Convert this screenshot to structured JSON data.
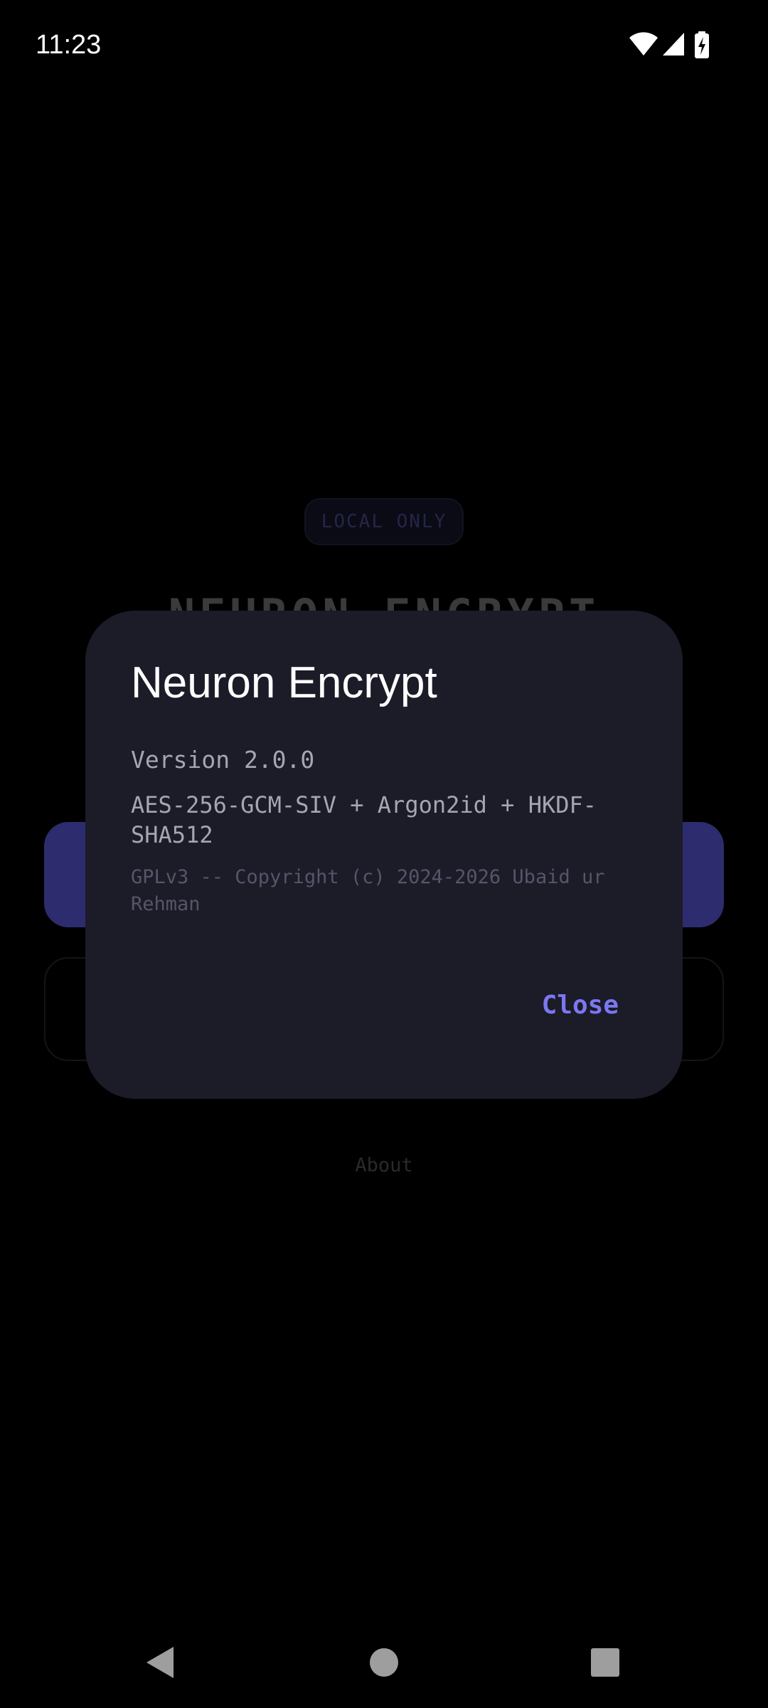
{
  "status_bar": {
    "time": "11:23",
    "icons": [
      "wifi-icon",
      "cellular-signal-icon",
      "battery-charging-icon"
    ]
  },
  "background": {
    "badge": "LOCAL ONLY",
    "title": "NEURON ENCRYPT",
    "about_link": "About"
  },
  "dialog": {
    "title": "Neuron Encrypt",
    "version": "Version 2.0.0",
    "algorithms": "AES-256-GCM-SIV + Argon2id + HKDF-SHA512",
    "license": "GPLv3 -- Copyright (c) 2024-2026 Ubaid ur Rehman",
    "close_label": "Close"
  },
  "nav_bar": {
    "icons": [
      "back-icon",
      "home-icon",
      "recents-icon"
    ]
  },
  "colors": {
    "background": "#000000",
    "dialog_surface": "#1c1b28",
    "accent": "#7b78f2",
    "primary_button_dimmed": "#2d2c6e"
  }
}
